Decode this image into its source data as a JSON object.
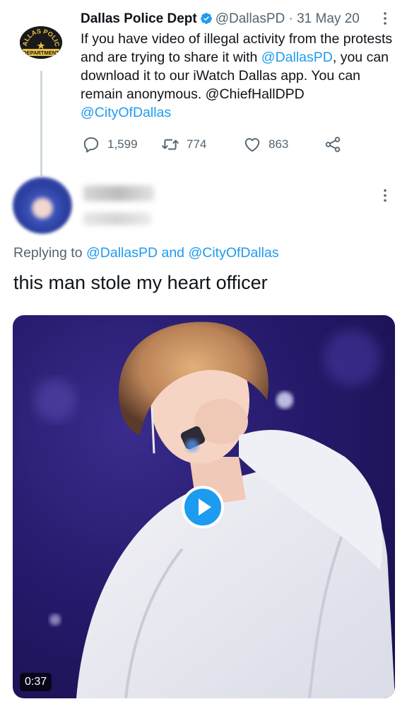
{
  "tweet": {
    "author_name": "Dallas Police Dept",
    "handle": "@DallasPD",
    "separator": "·",
    "date": "31 May 20",
    "text_1": "If you have video of illegal activity from the protests and are trying to share it with ",
    "mention_1": "@DallasPD",
    "text_2": ", you can download it to our iWatch Dallas app. You can remain anonymous. @ChiefHallDPD ",
    "mention_2": "@CityOfDallas",
    "avatar_text_top": "DALLAS POLICE",
    "avatar_text_bottom": "DEPARTMENT",
    "actions": {
      "replies": "1,599",
      "retweets": "774",
      "likes": "863"
    },
    "icons": [
      "verified-badge-icon",
      "more-icon",
      "reply-icon",
      "retweet-icon",
      "like-icon",
      "share-icon"
    ]
  },
  "reply": {
    "replying_prefix": "Replying to ",
    "replying_to_1": "@DallasPD",
    "replying_and": " and ",
    "replying_to_2": "@CityOfDallas",
    "text": "this man stole my heart officer",
    "video_duration": "0:37"
  },
  "colors": {
    "accent": "#1d9bf0",
    "text_primary": "#0f1419",
    "text_secondary": "#536471",
    "video_bg": "#251a6b"
  }
}
